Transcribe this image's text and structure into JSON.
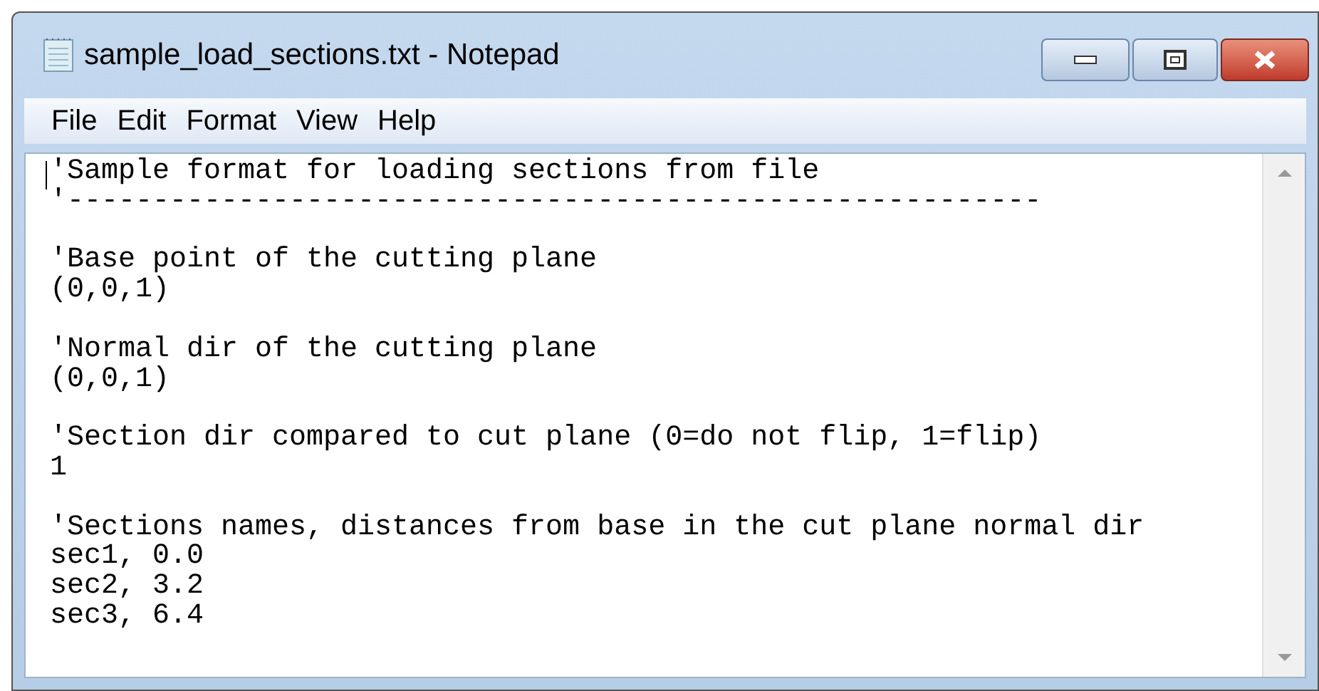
{
  "window": {
    "title": "sample_load_sections.txt - Notepad"
  },
  "menu": [
    "File",
    "Edit",
    "Format",
    "View",
    "Help"
  ],
  "editor": {
    "blocks": [
      [
        "'Sample format for loading sections from file",
        "'---------------------------------------------------------"
      ],
      [
        "'Base point of the cutting plane",
        "(0,0,1)"
      ],
      [
        "'Normal dir of the cutting plane",
        "(0,0,1)"
      ],
      [
        "'Section dir compared to cut plane (0=do not flip, 1=flip)",
        "1"
      ],
      [
        "'Sections names, distances from base in the cut plane normal dir",
        "sec1, 0.0",
        "sec2, 3.2",
        "sec3, 6.4"
      ]
    ]
  }
}
